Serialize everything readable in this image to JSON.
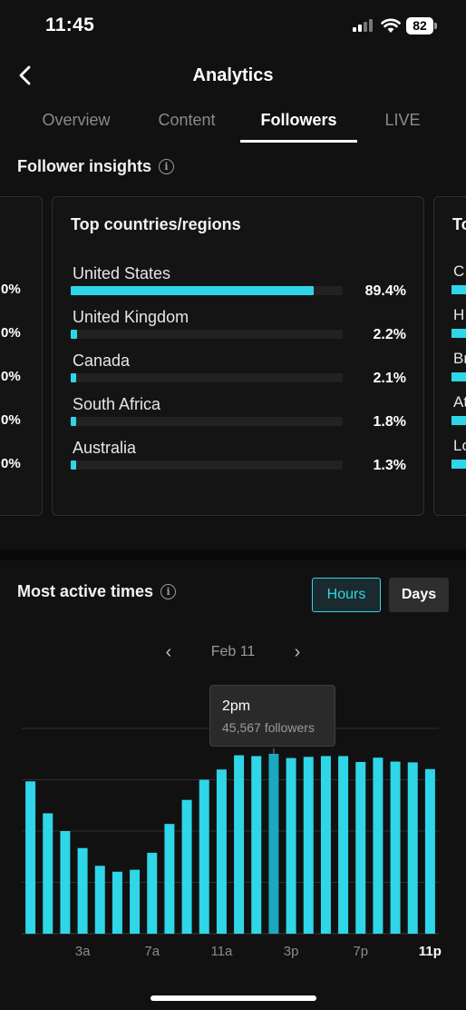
{
  "status_bar": {
    "time": "11:45",
    "battery": "82"
  },
  "header": {
    "title": "Analytics"
  },
  "tabs": [
    {
      "label": "Overview"
    },
    {
      "label": "Content"
    },
    {
      "label": "Followers"
    },
    {
      "label": "LIVE"
    }
  ],
  "follower_insights": {
    "title": "Follower insights",
    "left_card_percents": [
      "0%",
      "0%",
      "0%",
      "0%",
      "0%"
    ],
    "countries_card": {
      "title": "Top countries/regions",
      "rows": [
        {
          "name": "United States",
          "pct": "89.4%",
          "value": 89.4
        },
        {
          "name": "United Kingdom",
          "pct": "2.2%",
          "value": 2.2
        },
        {
          "name": "Canada",
          "pct": "2.1%",
          "value": 2.1
        },
        {
          "name": "South Africa",
          "pct": "1.8%",
          "value": 1.8
        },
        {
          "name": "Australia",
          "pct": "1.3%",
          "value": 1.3
        }
      ]
    },
    "right_card": {
      "title": "To",
      "initials": [
        "C",
        "H",
        "Br",
        "At",
        "Lo"
      ]
    }
  },
  "active_times": {
    "title": "Most active times",
    "toggle": {
      "hours": "Hours",
      "days": "Days",
      "selected": "hours"
    },
    "date_label": "Feb 11",
    "tooltip": {
      "title": "2pm",
      "subtitle": "45,567 followers"
    }
  },
  "colors": {
    "accent": "#2ed6e8",
    "accent_selected": "#1aa9bf",
    "background": "#111111"
  },
  "chart_data": {
    "type": "bar",
    "categories": [
      "0",
      "1",
      "2",
      "3",
      "4",
      "5",
      "6",
      "7",
      "8",
      "9",
      "10",
      "11",
      "12",
      "13",
      "14",
      "15",
      "16",
      "17",
      "18",
      "19",
      "20",
      "21",
      "22",
      "23"
    ],
    "values": [
      38600,
      30500,
      26000,
      21700,
      17200,
      15700,
      16200,
      20500,
      27800,
      33900,
      39000,
      41600,
      45200,
      45000,
      45567,
      44500,
      44800,
      45000,
      45000,
      43500,
      44600,
      43600,
      43400,
      41700
    ],
    "tick_labels": [
      {
        "index": 3,
        "label": "3a"
      },
      {
        "index": 7,
        "label": "7a"
      },
      {
        "index": 11,
        "label": "11a"
      },
      {
        "index": 15,
        "label": "3p"
      },
      {
        "index": 19,
        "label": "7p"
      },
      {
        "index": 23,
        "label": "11p",
        "bold": true
      }
    ],
    "highlight_index": 14,
    "ylim": [
      0,
      52000
    ],
    "grid": true
  }
}
